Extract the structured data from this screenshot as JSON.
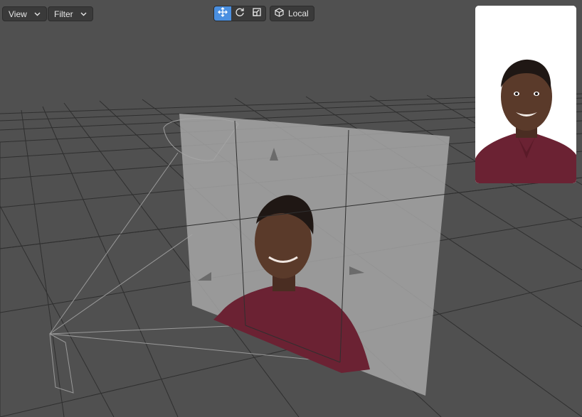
{
  "toolbar": {
    "view_label": "View",
    "filter_label": "Filter",
    "local_label": "Local",
    "tools": [
      {
        "name": "move-tool",
        "icon": "move-arrows-icon",
        "active": true
      },
      {
        "name": "rotate-tool",
        "icon": "rotate-icon",
        "active": false
      },
      {
        "name": "scale-tool",
        "icon": "scale-icon",
        "active": false
      }
    ],
    "local_icon": "cube-icon"
  },
  "colors": {
    "background": "#505050",
    "grid": "#2e2e2e",
    "active_tool": "#4a8fe0",
    "shirt": "#6b2233",
    "skin": "#5a3a2a"
  },
  "preview": {
    "icon": "camera-preview-portrait"
  }
}
